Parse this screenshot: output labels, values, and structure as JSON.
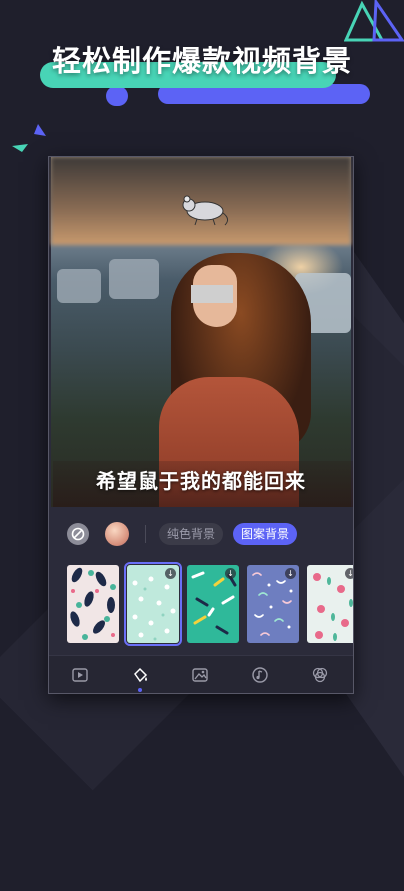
{
  "promo": {
    "headline": "轻松制作爆款视频背景"
  },
  "preview": {
    "caption": "希望鼠于我的都能回来"
  },
  "controls": {
    "none_icon": "no-background-icon",
    "gradient_swatch": "gradient-swatch",
    "tab_solid_label": "纯色背景",
    "tab_pattern_label": "图案背景",
    "active_tab": "图案背景"
  },
  "patterns": [
    {
      "name": "leaf-pattern",
      "selected": false,
      "download": false
    },
    {
      "name": "dots-pattern",
      "selected": true,
      "download": true
    },
    {
      "name": "confetti-pattern",
      "selected": false,
      "download": true
    },
    {
      "name": "squiggle-pattern",
      "selected": false,
      "download": true
    },
    {
      "name": "floral-pattern",
      "selected": false,
      "download": true
    }
  ],
  "toolbar": [
    {
      "icon": "video-add-icon"
    },
    {
      "icon": "paint-bucket-icon",
      "active": true
    },
    {
      "icon": "image-icon"
    },
    {
      "icon": "music-icon"
    },
    {
      "icon": "filter-icon"
    }
  ],
  "colors": {
    "accent_blue": "#5c63f5",
    "accent_green": "#48d4b6",
    "background": "#1f1f2c"
  }
}
